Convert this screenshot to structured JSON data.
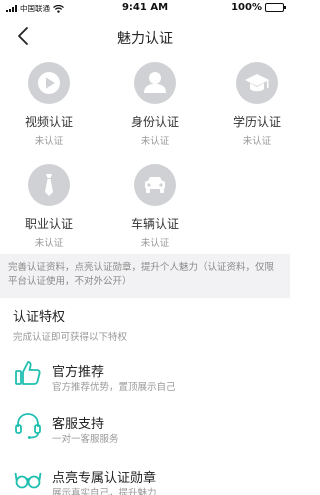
{
  "status_bar": {
    "carrier": "中国联通",
    "time": "9:41 AM",
    "battery": "100%"
  },
  "nav": {
    "title": "魅力认证"
  },
  "certifications": [
    {
      "name": "视频认证",
      "status": "未认证",
      "icon": "play-icon"
    },
    {
      "name": "身份认证",
      "status": "未认证",
      "icon": "user-icon"
    },
    {
      "name": "学历认证",
      "status": "未认证",
      "icon": "graduation-cap-icon"
    },
    {
      "name": "职业认证",
      "status": "未认证",
      "icon": "tie-icon"
    },
    {
      "name": "车辆认证",
      "status": "未认证",
      "icon": "car-icon"
    }
  ],
  "notice": "完善认证资料，点亮认证勋章，提升个人魅力（认证资料，仅限平台认证使用，不对外公开）",
  "privileges": {
    "title": "认证特权",
    "subtitle": "完成认证即可获得以下特权",
    "items": [
      {
        "title": "官方推荐",
        "desc": "官方推荐优势，置顶展示自己",
        "icon": "thumbs-up-icon"
      },
      {
        "title": "客服支持",
        "desc": "一对一客服服务",
        "icon": "headset-icon"
      },
      {
        "title": "点亮专属认证勋章",
        "desc": "展示真实自己，提升魅力",
        "icon": "glasses-icon"
      }
    ]
  },
  "colors": {
    "accent": "#1fbfb0",
    "icon_bg": "#cfd1d4",
    "notice_bg": "#f2f2f4"
  }
}
